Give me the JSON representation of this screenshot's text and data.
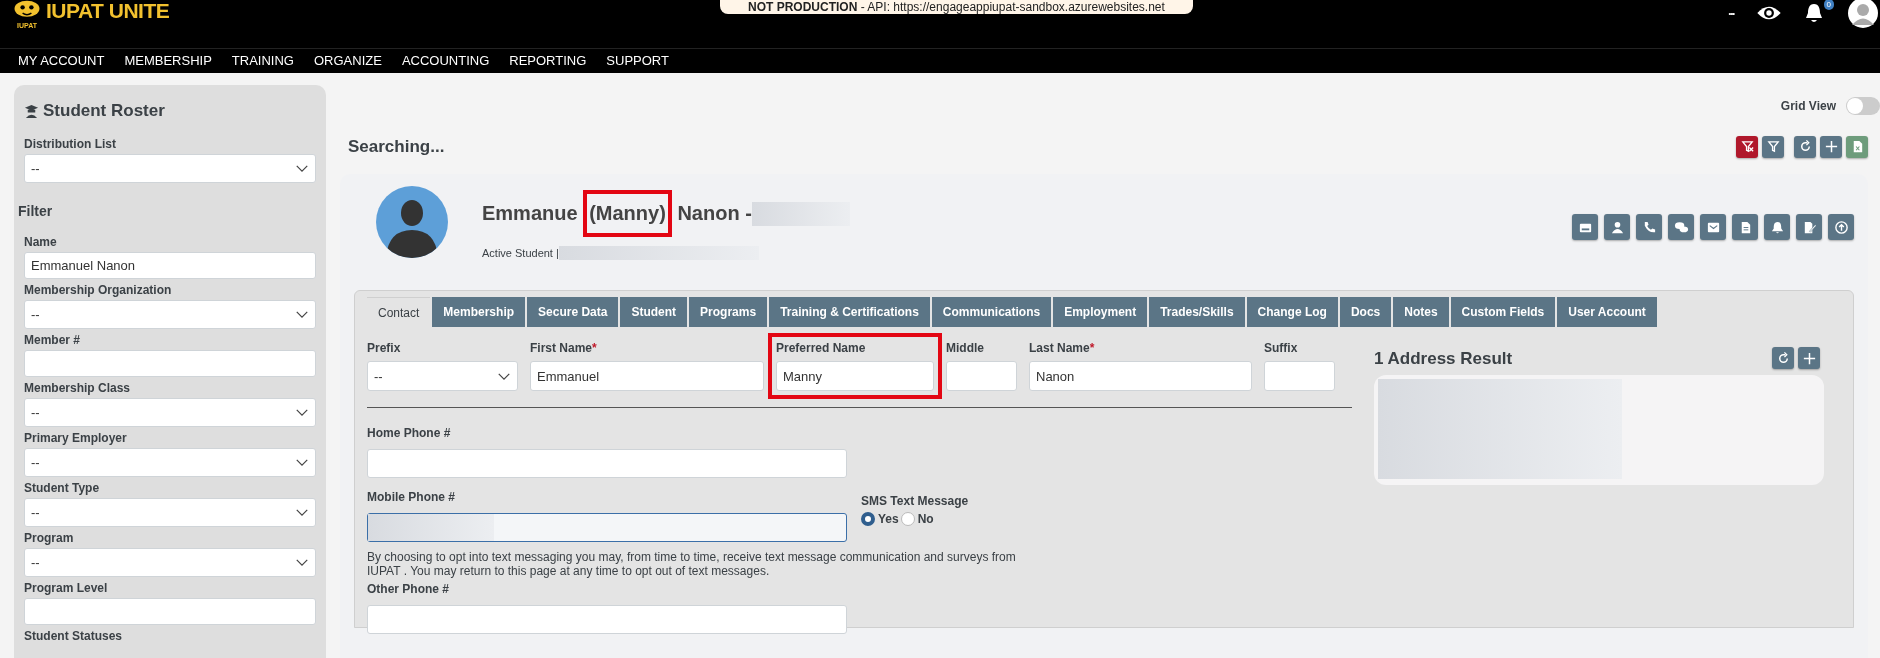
{
  "brand": {
    "name": "IUPAT UNITE",
    "caption": "IUPAT"
  },
  "environment_banner": "**NOT PRODUCTION** - API: https://engageappiupat-sandbox.azurewebsites.net",
  "header": {
    "more": "•••",
    "notification_badge": "0"
  },
  "nav": [
    "MY ACCOUNT",
    "MEMBERSHIP",
    "TRAINING",
    "ORGANIZE",
    "ACCOUNTING",
    "REPORTING",
    "SUPPORT"
  ],
  "sidebar": {
    "title": "Student Roster",
    "distribution_list": {
      "label": "Distribution List",
      "value": "--"
    },
    "filter_title": "Filter",
    "filters": [
      {
        "label": "Name",
        "kind": "text",
        "value": "Emmanuel Nanon"
      },
      {
        "label": "Membership Organization",
        "kind": "select",
        "value": "--"
      },
      {
        "label": "Member #",
        "kind": "text"
      },
      {
        "label": "Membership Class",
        "kind": "select",
        "value": "--"
      },
      {
        "label": "Primary Employer",
        "kind": "select",
        "value": "--"
      },
      {
        "label": "Student Type",
        "kind": "select",
        "value": "--"
      },
      {
        "label": "Program",
        "kind": "select",
        "value": "--"
      },
      {
        "label": "Program Level",
        "kind": "text"
      },
      {
        "label": "Student Statuses",
        "kind": "label"
      }
    ]
  },
  "grid_view": {
    "label": "Grid View",
    "on": false
  },
  "status": "Searching...",
  "toolbar": [
    {
      "kind": "clear-filter",
      "color": "#b0182b"
    },
    {
      "kind": "filter",
      "color": "#5b7586"
    },
    {
      "kind": "refresh",
      "color": "#5b7586"
    },
    {
      "kind": "add",
      "color": "#5b7586"
    },
    {
      "kind": "excel",
      "color": "#6e9c7c"
    }
  ],
  "profile": {
    "first": "Emmanue",
    "nickname": "(Manny)",
    "nickname_highlighted": true,
    "last": "Nanon -",
    "id_redacted": true,
    "status": "Active Student |",
    "detail_redacted": true,
    "actions": [
      {
        "kind": "card"
      },
      {
        "kind": "person"
      },
      {
        "kind": "phone"
      },
      {
        "kind": "chat"
      },
      {
        "kind": "mail"
      },
      {
        "kind": "document"
      },
      {
        "kind": "bell"
      },
      {
        "kind": "edit"
      },
      {
        "kind": "upload"
      }
    ]
  },
  "tabs": [
    {
      "label": "Contact",
      "selected": true
    },
    {
      "label": "Membership",
      "selected": false
    },
    {
      "label": "Secure Data",
      "selected": false
    },
    {
      "label": "Student",
      "selected": false
    },
    {
      "label": "Programs",
      "selected": false
    },
    {
      "label": "Training & Certifications",
      "selected": false
    },
    {
      "label": "Communications",
      "selected": false
    },
    {
      "label": "Employment",
      "selected": false
    },
    {
      "label": "Trades/Skills",
      "selected": false
    },
    {
      "label": "Change Log",
      "selected": false
    },
    {
      "label": "Docs",
      "selected": false
    },
    {
      "label": "Notes",
      "selected": false
    },
    {
      "label": "Custom Fields",
      "selected": false
    },
    {
      "label": "User Account",
      "selected": false
    }
  ],
  "name_fields": [
    {
      "label": "Prefix",
      "kind": "select",
      "value": "--",
      "highlighted": false
    },
    {
      "label": "First Name",
      "required_mark": "*",
      "kind": "text",
      "value": "Emmanuel",
      "highlighted": false
    },
    {
      "label": "Preferred Name",
      "kind": "text",
      "value": "Manny",
      "highlighted": true
    },
    {
      "label": "Middle",
      "kind": "text",
      "highlighted": false
    },
    {
      "label": "Last Name",
      "required_mark": "*",
      "kind": "text",
      "value": "Nanon",
      "highlighted": false
    },
    {
      "label": "Suffix",
      "kind": "text",
      "highlighted": false
    }
  ],
  "home_phone": {
    "label": "Home Phone #"
  },
  "mobile_phone": {
    "label": "Mobile Phone #",
    "redacted": true
  },
  "sms": {
    "label": "SMS Text Message",
    "options": [
      {
        "label": "Yes",
        "selected": true
      },
      {
        "label": "No",
        "selected": false
      }
    ]
  },
  "sms_disclaimer": "By choosing to opt into text messaging you may, from time to time, receive text message communication and surveys from IUPAT . You may return to this page at any time to opt out of text messages.",
  "other_phone": {
    "label": "Other Phone #"
  },
  "address": {
    "title": "1 Address Result",
    "redacted": true
  }
}
